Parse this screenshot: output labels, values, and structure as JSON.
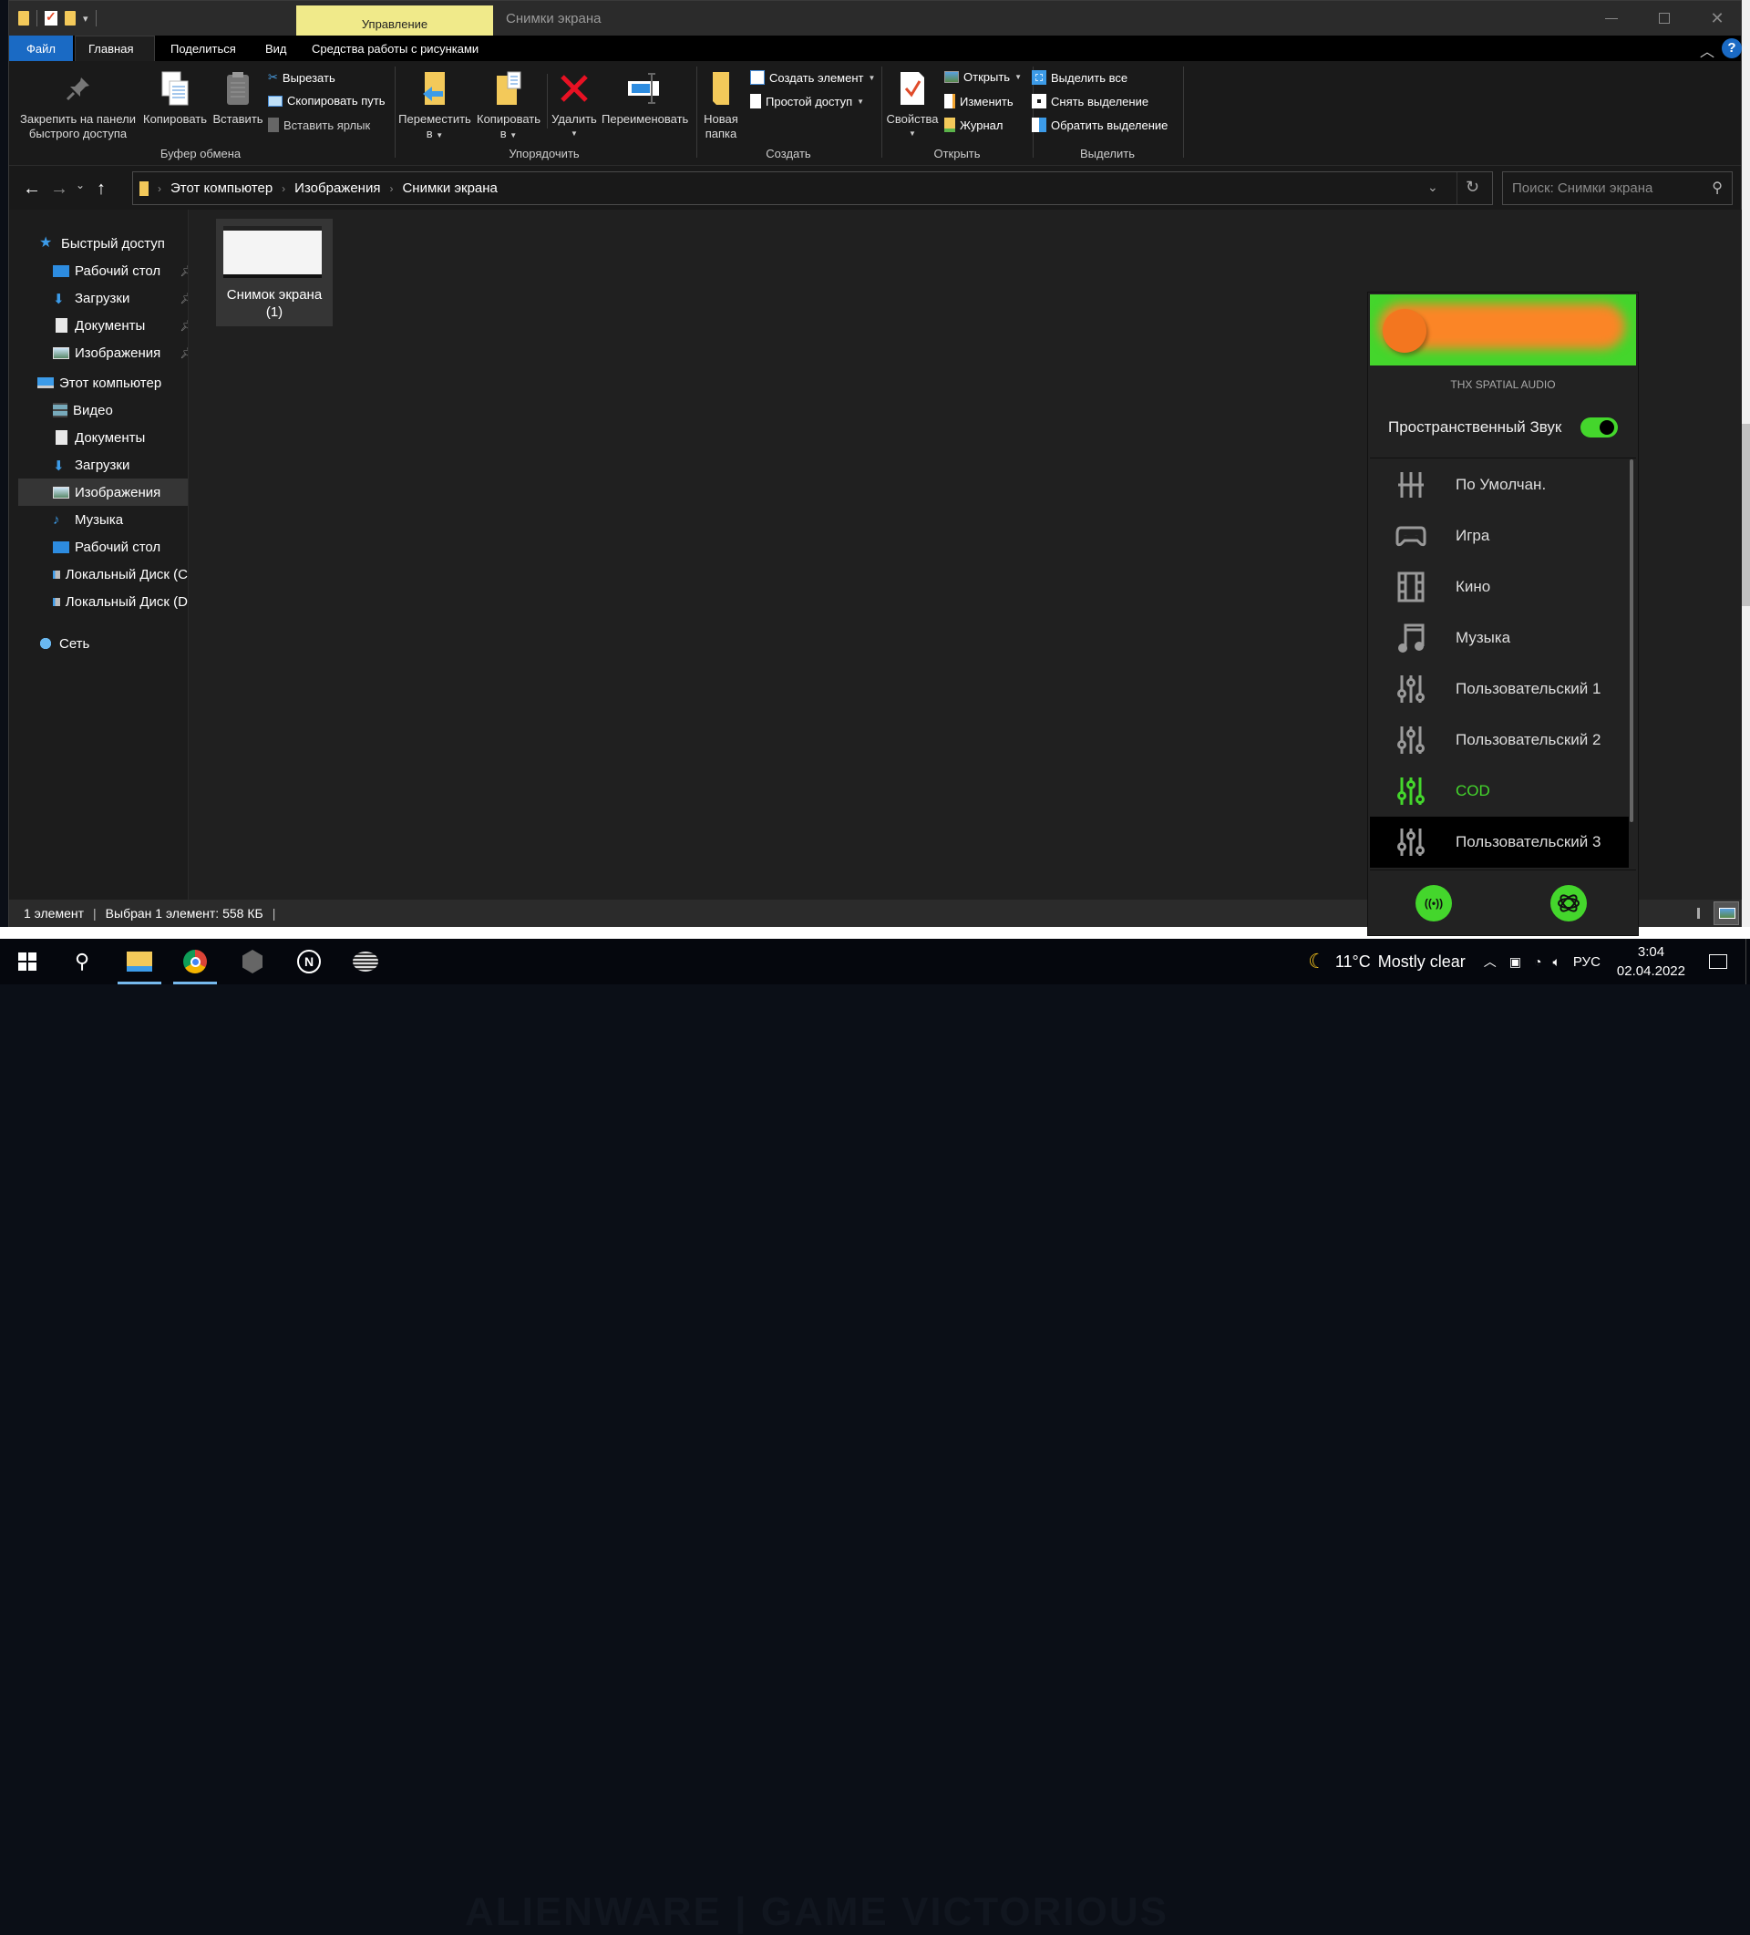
{
  "window": {
    "title": "Снимки экрана",
    "context_tab": "Управление",
    "controls": {
      "minimize": "—",
      "maximize": "☐",
      "close": "✕"
    }
  },
  "ribbon_tabs": [
    {
      "label": "Файл"
    },
    {
      "label": "Главная"
    },
    {
      "label": "Поделиться"
    },
    {
      "label": "Вид"
    },
    {
      "label": "Средства работы с рисунками"
    }
  ],
  "ribbon": {
    "clipboard": {
      "group_label": "Буфер обмена",
      "pin_label_1": "Закрепить на панели",
      "pin_label_2": "быстрого доступа",
      "copy": "Копировать",
      "paste": "Вставить",
      "cut": "Вырезать",
      "copy_path": "Скопировать путь",
      "paste_shortcut": "Вставить ярлык"
    },
    "organize": {
      "group_label": "Упорядочить",
      "move_to_1": "Переместить",
      "move_to_2": "в",
      "copy_to_1": "Копировать",
      "copy_to_2": "в",
      "delete": "Удалить",
      "rename": "Переименовать"
    },
    "new": {
      "group_label": "Создать",
      "new_folder_1": "Новая",
      "new_folder_2": "папка",
      "new_item": "Создать элемент",
      "easy_access": "Простой доступ"
    },
    "open": {
      "group_label": "Открыть",
      "properties": "Свойства",
      "open": "Открыть",
      "edit": "Изменить",
      "history": "Журнал"
    },
    "select": {
      "group_label": "Выделить",
      "select_all": "Выделить все",
      "select_none": "Снять выделение",
      "invert": "Обратить выделение"
    }
  },
  "address": {
    "crumbs": [
      "Этот компьютер",
      "Изображения",
      "Снимки экрана"
    ],
    "search_placeholder": "Поиск: Снимки экрана"
  },
  "sidebar": {
    "quick_access": "Быстрый доступ",
    "quick_items": [
      {
        "label": "Рабочий стол",
        "icon": "desktop-icon"
      },
      {
        "label": "Загрузки",
        "icon": "downloads-icon"
      },
      {
        "label": "Документы",
        "icon": "documents-icon"
      },
      {
        "label": "Изображения",
        "icon": "pictures-icon"
      }
    ],
    "this_pc": "Этот компьютер",
    "pc_items": [
      {
        "label": "Видео",
        "icon": "video-icon"
      },
      {
        "label": "Документы",
        "icon": "documents-icon"
      },
      {
        "label": "Загрузки",
        "icon": "downloads-icon"
      },
      {
        "label": "Изображения",
        "icon": "pictures-icon",
        "selected": true
      },
      {
        "label": "Музыка",
        "icon": "music-icon"
      },
      {
        "label": "Рабочий стол",
        "icon": "desktop-icon"
      },
      {
        "label": "Локальный Диск (C",
        "icon": "drive-icon"
      },
      {
        "label": "Локальный Диск (D",
        "icon": "drive-icon"
      }
    ],
    "network": "Сеть"
  },
  "files": [
    {
      "name_line1": "Снимок экрана",
      "name_line2": "(1)",
      "selected": true
    }
  ],
  "status": {
    "count": "1 элемент",
    "selection": "Выбран 1 элемент: 558 КБ"
  },
  "thx": {
    "subtitle": "THX SPATIAL AUDIO",
    "spatial_label": "Пространственный Звук",
    "spatial_on": true,
    "accent": "#44d62c",
    "modes": [
      {
        "label": "По Умолчан.",
        "icon": "equalizer-icon"
      },
      {
        "label": "Игра",
        "icon": "gamepad-icon"
      },
      {
        "label": "Кино",
        "icon": "film-icon"
      },
      {
        "label": "Музыка",
        "icon": "music-note-icon"
      },
      {
        "label": "Пользовательский 1",
        "icon": "sliders-icon"
      },
      {
        "label": "Пользовательский 2",
        "icon": "sliders-icon"
      },
      {
        "label": "COD",
        "icon": "sliders-icon",
        "active": true
      },
      {
        "label": "Пользовательский 3",
        "icon": "sliders-icon",
        "hover": true
      }
    ]
  },
  "taskbar": {
    "banner": "ALIENWARE  |  GAME VICTORIOUS",
    "weather_temp": "11°C",
    "weather_text": "Mostly clear",
    "language": "РУС",
    "time": "3:04",
    "date": "02.04.2022"
  }
}
